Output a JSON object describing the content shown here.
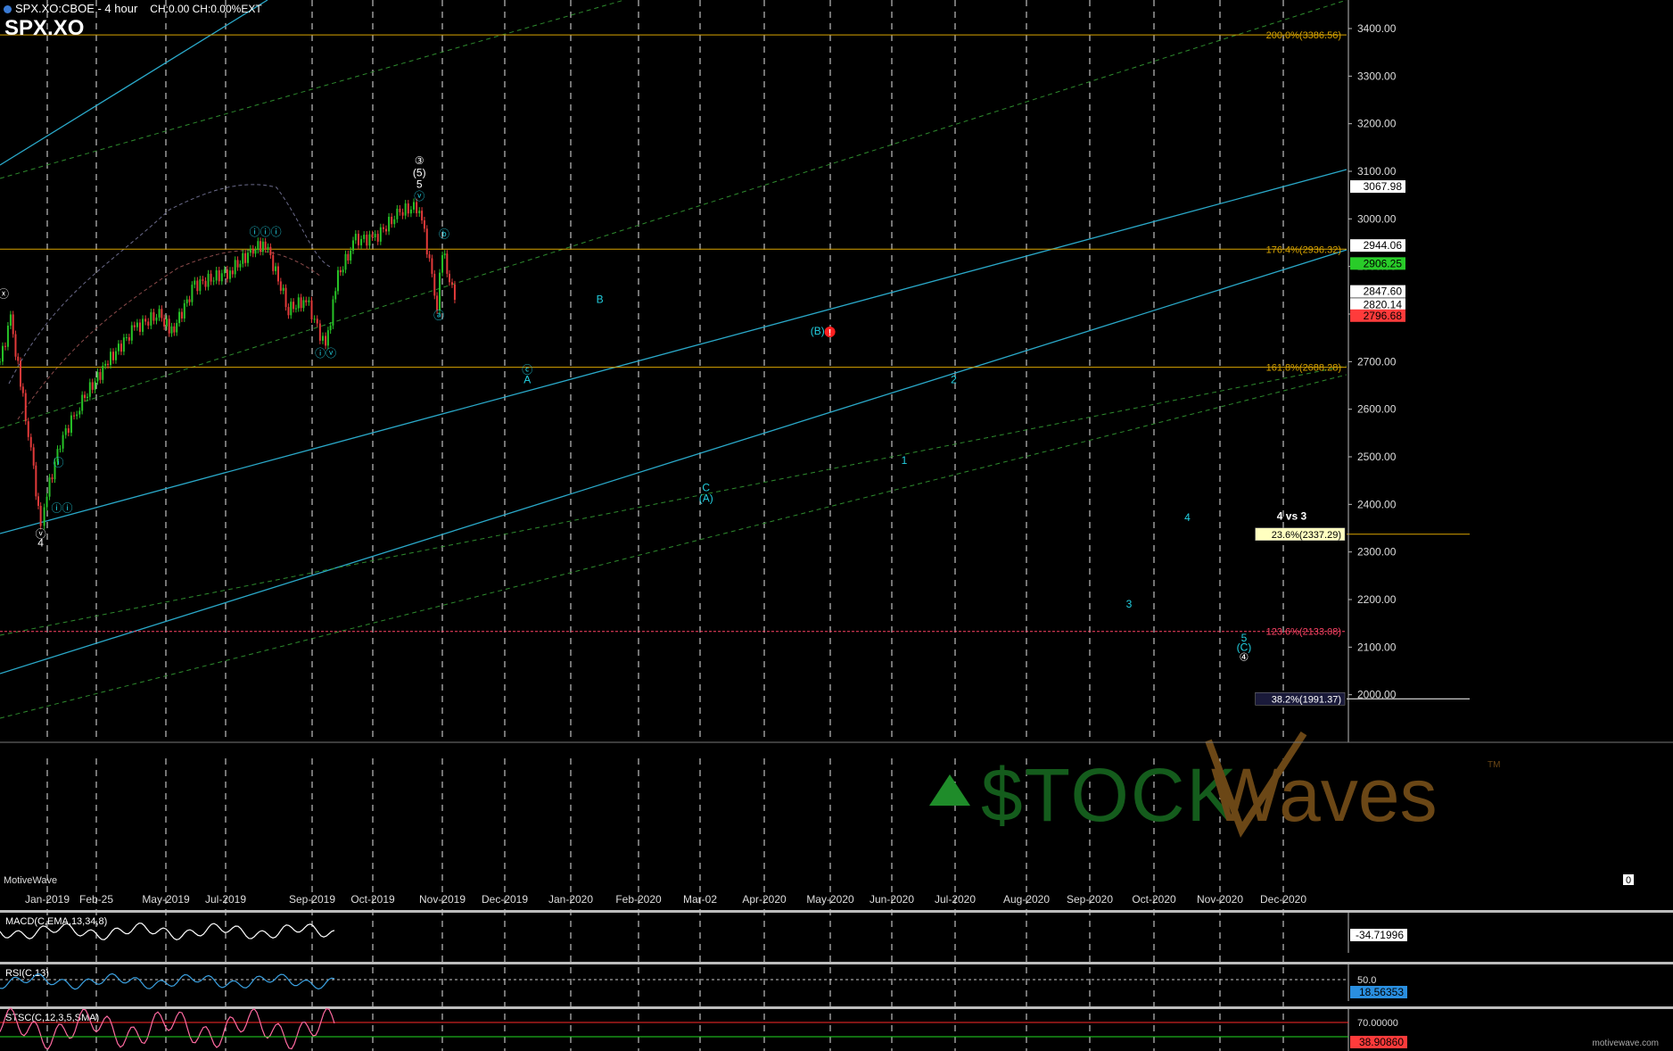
{
  "header": {
    "title": "SPX.XO:CBOE - 4 hour",
    "change": "CH:0.00 CH:0.00%EXT",
    "symbol": "SPX.XO"
  },
  "watermark": "MotiveWave",
  "footer_credit": "motivewave.com",
  "logo": {
    "stock": "$TOCK",
    "waves": "Waves",
    "tm": "TM"
  },
  "chart_data": {
    "type": "line",
    "title": "SPX.XO:CBOE - 4 hour",
    "ylim": [
      1900,
      3460
    ],
    "yticks": [
      2000,
      2100,
      2200,
      2300,
      2400,
      2500,
      2600,
      2700,
      2800,
      2900,
      3000,
      3100,
      3200,
      3300,
      3400
    ],
    "ytick_labels": [
      "2000.00",
      "2100.00",
      "2200.00",
      "2300.00",
      "2400.00",
      "2500.00",
      "2600.00",
      "2700.00",
      "2800.00",
      "2900.00",
      "3000.00",
      "3100.00",
      "3200.00",
      "3300.00",
      "3400.00"
    ],
    "x_labels": [
      "Jan-2019",
      "Feb-25",
      "May-2019",
      "Jul-2019",
      "Sep-2019",
      "Oct-2019",
      "Nov-2019",
      "Dec-2019",
      "Jan-2020",
      "Feb-2020",
      "Mar-02",
      "Apr-2020",
      "May-2020",
      "Jun-2020",
      "Jul-2020",
      "Aug-2020",
      "Sep-2020",
      "Oct-2020",
      "Nov-2020",
      "Dec-2020"
    ],
    "price_path": {
      "x": [
        "2018-12-01",
        "2018-12-07",
        "2018-12-14",
        "2018-12-20",
        "2018-12-24",
        "2018-12-26",
        "2019-01-04",
        "2019-01-15",
        "2019-01-31",
        "2019-02-15",
        "2019-03-01",
        "2019-03-08",
        "2019-03-21",
        "2019-04-10",
        "2019-04-23",
        "2019-04-30",
        "2019-05-13",
        "2019-05-23",
        "2019-06-03",
        "2019-06-10",
        "2019-06-20",
        "2019-07-01",
        "2019-07-15",
        "2019-07-26",
        "2019-08-05",
        "2019-08-08",
        "2019-08-12",
        "2019-08-15"
      ],
      "y": [
        2700,
        2790,
        2620,
        2470,
        2351,
        2400,
        2530,
        2610,
        2700,
        2770,
        2800,
        2760,
        2860,
        2890,
        2935,
        2950,
        2810,
        2830,
        2729,
        2880,
        2955,
        2960,
        3015,
        3027,
        2822,
        2935,
        2870,
        2830
      ]
    },
    "horizontal_levels": [
      {
        "label": "200.0%(3386.56)",
        "value": 3386.56,
        "color": "#d9a400"
      },
      {
        "label": "176.4%(2936.32)",
        "value": 2936.32,
        "color": "#d9a400"
      },
      {
        "label": "161.8%(2688.28)",
        "value": 2688.28,
        "color": "#d9a400"
      },
      {
        "label": "23.6%(2337.29)",
        "value": 2337.29,
        "color": "#d9a400"
      },
      {
        "label": "123.6%(2133.08)",
        "value": 2133.08,
        "color": "#ff4466"
      },
      {
        "label": "38.2%(1991.37)",
        "value": 1991.37,
        "color": "#ffffff"
      }
    ],
    "price_tags": [
      {
        "label": "3067.98",
        "value": 3067.98,
        "bg": "#ffffff",
        "fg": "#000000"
      },
      {
        "label": "2944.06",
        "value": 2944.06,
        "bg": "#ffffff",
        "fg": "#000000"
      },
      {
        "label": "2906.25",
        "value": 2906.25,
        "bg": "#29cc29",
        "fg": "#000000"
      },
      {
        "label": "2847.60",
        "value": 2847.6,
        "bg": "#ffffff",
        "fg": "#000000"
      },
      {
        "label": "2820.14",
        "value": 2820.14,
        "bg": "#ffffff",
        "fg": "#000000"
      },
      {
        "label": "2796.68",
        "value": 2796.68,
        "bg": "#ff3b3b",
        "fg": "#000000"
      }
    ],
    "wave_labels": [
      {
        "text": "ⓧ",
        "x": "2018-12-03",
        "y": 2835,
        "color": "#ffffff"
      },
      {
        "text": "③",
        "x": "2019-07-26",
        "y": 3115,
        "color": "#ffffff"
      },
      {
        "text": "(5)",
        "x": "2019-07-26",
        "y": 3090,
        "color": "#ffffff"
      },
      {
        "text": "5",
        "x": "2019-07-26",
        "y": 3065,
        "color": "#ffffff"
      },
      {
        "text": "ⓥ",
        "x": "2019-07-26",
        "y": 3040,
        "color": "#22cfe0"
      },
      {
        "text": "ⓑ",
        "x": "2019-08-09",
        "y": 2960,
        "color": "#22cfe0"
      },
      {
        "text": "ⓐ",
        "x": "2019-08-06",
        "y": 2790,
        "color": "#22cfe0"
      },
      {
        "text": "ⓘⓘⓘ",
        "x": "2019-04-30",
        "y": 2965,
        "color": "#22cfe0"
      },
      {
        "text": "ⓘⓥ",
        "x": "2019-06-03",
        "y": 2710,
        "color": "#22cfe0"
      },
      {
        "text": "ⓘ",
        "x": "2019-01-03",
        "y": 2480,
        "color": "#22cfe0"
      },
      {
        "text": "ⓘⓘ",
        "x": "2019-01-05",
        "y": 2385,
        "color": "#22cfe0"
      },
      {
        "text": "ⓥ",
        "x": "2018-12-24",
        "y": 2330,
        "color": "#ffffff"
      },
      {
        "text": "4",
        "x": "2018-12-24",
        "y": 2312,
        "color": "#ffffff"
      },
      {
        "text": "B",
        "x": "2019-11-05",
        "y": 2823,
        "color": "#22cfe0"
      },
      {
        "text": "ⓒ",
        "x": "2019-09-25",
        "y": 2675,
        "color": "#22cfe0"
      },
      {
        "text": "A",
        "x": "2019-09-25",
        "y": 2655,
        "color": "#22cfe0"
      },
      {
        "text": "C",
        "x": "2020-01-04",
        "y": 2428,
        "color": "#22cfe0"
      },
      {
        "text": "(A)",
        "x": "2020-01-04",
        "y": 2405,
        "color": "#22cfe0"
      },
      {
        "text": "(B)",
        "x": "2020-03-07",
        "y": 2757,
        "color": "#22cfe0"
      },
      {
        "text": "!",
        "x": "2020-03-14",
        "y": 2755,
        "color": "#ffffff"
      },
      {
        "text": "1",
        "x": "2020-04-25",
        "y": 2485,
        "color": "#22cfe0"
      },
      {
        "text": "2",
        "x": "2020-05-23",
        "y": 2655,
        "color": "#22cfe0"
      },
      {
        "text": "3",
        "x": "2020-08-30",
        "y": 2183,
        "color": "#22cfe0"
      },
      {
        "text": "4",
        "x": "2020-10-02",
        "y": 2365,
        "color": "#22cfe0"
      },
      {
        "text": "4 vs 3",
        "x": "2020-11-30",
        "y": 2368,
        "color": "#ffffff"
      },
      {
        "text": "5",
        "x": "2020-11-03",
        "y": 2112,
        "color": "#22cfe0"
      },
      {
        "text": "(C)",
        "x": "2020-11-03",
        "y": 2092,
        "color": "#22cfe0"
      },
      {
        "text": "④",
        "x": "2020-11-03",
        "y": 2072,
        "color": "#ffffff"
      }
    ]
  },
  "indicators": [
    {
      "name": "MACD(C,EMA,13,34,8)",
      "value_label": "-34.71996"
    },
    {
      "name": "RSI(C,13)",
      "value_label": "18.56353",
      "ref_label": "50.0"
    },
    {
      "name": "STSC(C,12,3,5,SMA)",
      "value_label": "38.90860",
      "ref_label": "70.00000"
    }
  ],
  "axis_corner": "0",
  "colors": {
    "background": "#000000",
    "grid": "#e6e6e6",
    "fib": "#d9a400",
    "wave": "#22cfe0",
    "channel": "#2aa9c9",
    "ma_green": "#2e8b2e",
    "bull_candle": "#27c227",
    "bear_candle": "#e23a3a"
  }
}
